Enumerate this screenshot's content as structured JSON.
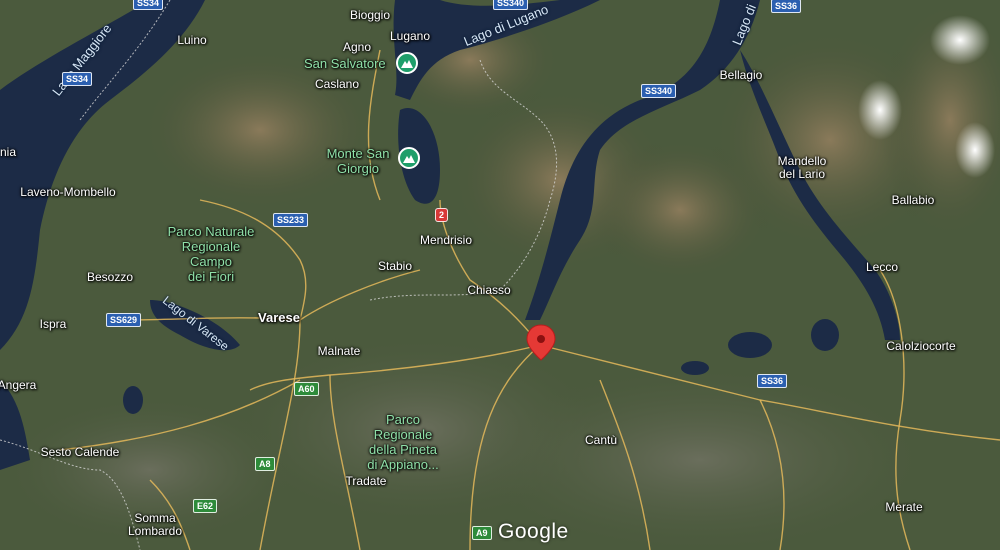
{
  "map": {
    "type": "satellite",
    "colors": {
      "water": "#1b2a45",
      "land": "#4a5a3c",
      "road": "#e4b85a",
      "border": "#d0d0d0",
      "marker": "#e53935",
      "poi": "#1e9e6a",
      "park_text": "#8fe0a8"
    },
    "places": {
      "bioggio": "Bioggio",
      "lugano": "Lugano",
      "agno": "Agno",
      "caslano": "Caslano",
      "luino": "Luino",
      "laveno": "Laveno-Mombello",
      "besozzo": "Besozzo",
      "ispra": "Ispra",
      "angera": "Angera",
      "sesto": "Sesto Calende",
      "somma": "Somma\nLombardo",
      "varese": "Varese",
      "malnate": "Malnate",
      "tradate": "Tradate",
      "stabio": "Stabio",
      "mendrisio": "Mendrisio",
      "chiasso": "Chiasso",
      "cantu": "Cantù",
      "bellagio": "Bellagio",
      "mandello": "Mandello\ndel Lario",
      "ballabio": "Ballabio",
      "lecco": "Lecco",
      "calolziocorte": "Calolziocorte",
      "merate": "Merate",
      "nia": "nia"
    },
    "pois": {
      "san_salvatore": "San Salvatore",
      "monte_san_giorgio": "Monte San\nGiorgio"
    },
    "parks": {
      "campo_dei_fiori": "Parco Naturale\nRegionale\nCampo\ndei Fiori",
      "pineta": "Parco\nRegionale\ndella Pineta\ndi Appiano..."
    },
    "lakes": {
      "maggiore": "Lago Maggiore",
      "lugano": "Lago di Lugano",
      "como": "Lago di",
      "varese": "Lago di Varese"
    },
    "roads": {
      "ss34_top": "SS34",
      "ss340_top": "SS340",
      "ss36_top": "SS36",
      "ss34": "SS34",
      "ss340": "SS340",
      "ss233": "SS233",
      "ss629": "SS629",
      "ss36": "SS36",
      "a60": "A60",
      "a8": "A8",
      "e62": "E62",
      "a9": "A9",
      "ch2": "2"
    },
    "attribution": "Google"
  }
}
